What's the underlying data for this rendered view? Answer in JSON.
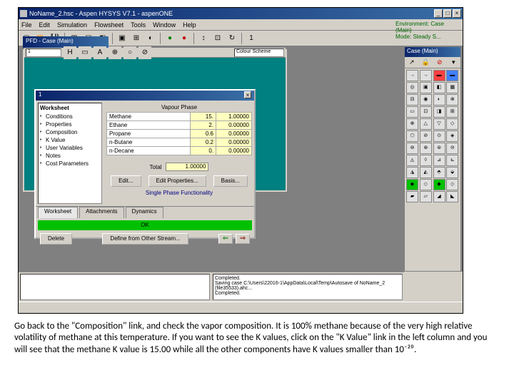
{
  "title": "NoName_2.hsc - Aspen HYSYS V7.1 - aspenONE",
  "menu": [
    "File",
    "Edit",
    "Simulation",
    "Flowsheet",
    "Tools",
    "Window",
    "Help"
  ],
  "env": {
    "label": "Environment: Case (Main)",
    "mode": "Mode: Steady S..."
  },
  "pfd": {
    "title": "PFD - Case (Main)",
    "sel": "1",
    "scheme": "Colour Scheme"
  },
  "palette": {
    "title": "Case (Main)"
  },
  "dialog": {
    "title": "1",
    "tree_title": "Worksheet",
    "tree": [
      "Conditions",
      "Properties",
      "Composition",
      "K Value",
      "User Variables",
      "Notes",
      "Cost Parameters"
    ],
    "group": "Vapour Phase",
    "rows": [
      {
        "c": "Methane",
        "k": "15.",
        "v": "1.00000"
      },
      {
        "c": "Ethane",
        "k": "2.",
        "v": "0.00000"
      },
      {
        "c": "Propane",
        "k": "0.6",
        "v": "0.00000"
      },
      {
        "c": "n-Butane",
        "k": "0.2",
        "v": "0.00000"
      },
      {
        "c": "n-Decane",
        "k": "0.",
        "v": "0.00000"
      }
    ],
    "total_lbl": "Total",
    "total": "1.00000",
    "btns": [
      "Edit...",
      "Edit Properties...",
      "Basis..."
    ],
    "phase_link": "Single Phase Functionality",
    "tabs": [
      "Worksheet",
      "Attachments",
      "Dynamics"
    ],
    "status": "OK",
    "delete": "Delete",
    "define": "Define from Other Stream..."
  },
  "log": {
    "a": "",
    "b": "Completed.\nSaving case C:\\Users\\22016-1\\AppData\\Local\\Temp\\Autosave of NoName_2 (file35533).ahc...\nCompleted."
  },
  "caption": "Go back to the \"Composition\" link, and check the vapor composition. It is 100% methane because of the very high relative volatility of methane at this temperature. If you want to see the K values, click on the \"K Value\" link in the left column and you will see that the methane K value is 15.00 while all the other components have K values smaller than 10⁻²⁰."
}
